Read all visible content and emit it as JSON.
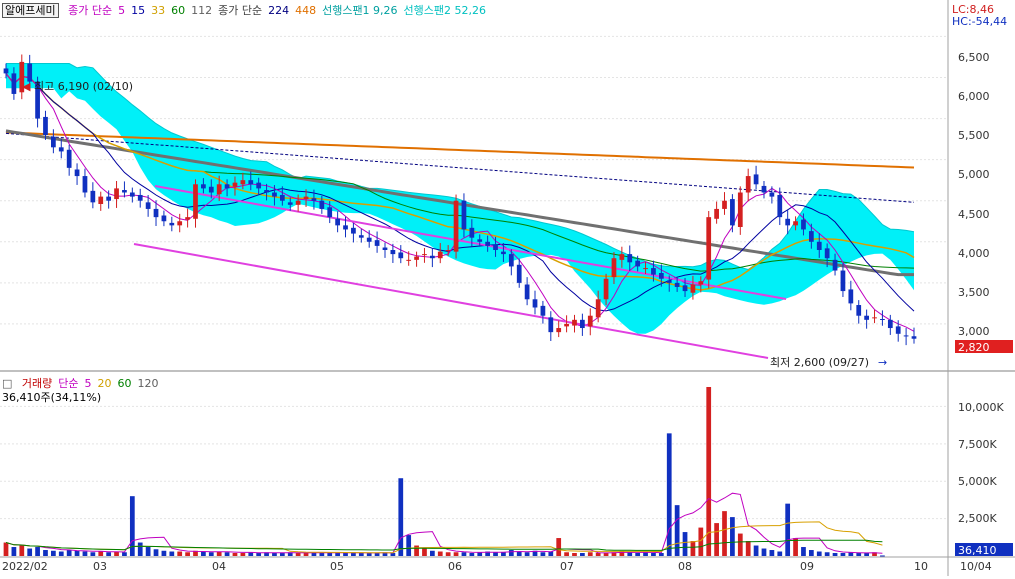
{
  "stock_name": "알에프세미",
  "price_legend": {
    "items": [
      {
        "text": "종가 단순",
        "color": "#c000c0"
      },
      {
        "text": "5",
        "color": "#c000c0"
      },
      {
        "text": "15",
        "color": "#0000a0"
      },
      {
        "text": "33",
        "color": "#d0a000"
      },
      {
        "text": "60",
        "color": "#008000"
      },
      {
        "text": "112",
        "color": "#606060"
      },
      {
        "text": "종가 단순",
        "color": "#404040"
      },
      {
        "text": "224",
        "color": "#000080"
      },
      {
        "text": "448",
        "color": "#e07000"
      },
      {
        "text": "선행스팬1 9,26",
        "color": "#00a0a0"
      },
      {
        "text": "선행스팬2 52,26",
        "color": "#00c0c0"
      }
    ]
  },
  "corner_info": {
    "lc": "LC:8,46",
    "hc": "HC:-54,44"
  },
  "high_annotation": "최고 6,190 (02/10)",
  "low_annotation": "최저 2,600 (09/27)",
  "price_axis": {
    "ticks": [
      "6,500",
      "6,000",
      "5,500",
      "5,000",
      "4,500",
      "4,000",
      "3,500",
      "3,000"
    ],
    "current": "2,820"
  },
  "volume_legend": {
    "items": [
      {
        "text": "거래량",
        "color": "#c00000"
      },
      {
        "text": "단순",
        "color": "#c000c0"
      },
      {
        "text": "5",
        "color": "#c000c0"
      },
      {
        "text": "20",
        "color": "#d0a000"
      },
      {
        "text": "60",
        "color": "#008000"
      },
      {
        "text": "120",
        "color": "#606060"
      }
    ],
    "value": "36,410주(34,11%)"
  },
  "volume_axis": {
    "ticks": [
      "10,000K",
      "7,500K",
      "5,000K",
      "2,500K"
    ],
    "current": "36,410"
  },
  "x_axis": {
    "labels": [
      "2022/02",
      "03",
      "04",
      "05",
      "06",
      "07",
      "08",
      "09",
      "10",
      "10/04"
    ]
  },
  "colors": {
    "up": "#d42020",
    "down": "#1030c0",
    "cloud": "#00f0f8",
    "trendline": "#e040e0",
    "ma448": "#e07000",
    "ma224": "#000080",
    "ma112": "#707070"
  },
  "chart_data": {
    "type": "candlestick",
    "price_ylim": [
      2500,
      6700
    ],
    "volume_ylim": [
      0,
      11500000
    ],
    "close": [
      6050,
      5800,
      6190,
      5950,
      5500,
      5300,
      5150,
      5100,
      4900,
      4800,
      4600,
      4480,
      4550,
      4500,
      4650,
      4600,
      4550,
      4500,
      4400,
      4300,
      4250,
      4200,
      4250,
      4300,
      4700,
      4650,
      4600,
      4700,
      4650,
      4720,
      4750,
      4700,
      4650,
      4600,
      4550,
      4500,
      4450,
      4500,
      4550,
      4500,
      4400,
      4300,
      4200,
      4150,
      4100,
      4050,
      4000,
      3950,
      3900,
      3850,
      3800,
      3780,
      3820,
      3850,
      3800,
      3880,
      3900,
      4500,
      4150,
      4050,
      4000,
      3950,
      3900,
      3850,
      3700,
      3500,
      3300,
      3200,
      3100,
      2900,
      2950,
      3000,
      3050,
      2950,
      3100,
      3300,
      3550,
      3800,
      3850,
      3750,
      3700,
      3680,
      3600,
      3550,
      3500,
      3450,
      3400,
      3480,
      3520,
      4300,
      4400,
      4500,
      4200,
      4600,
      4800,
      4700,
      4600,
      4550,
      4300,
      4200,
      4250,
      4150,
      4000,
      3900,
      3800,
      3650,
      3400,
      3250,
      3100,
      3050,
      3080,
      3050,
      2950,
      2880,
      2850,
      2820
    ],
    "volume": [
      900000,
      600000,
      700000,
      500000,
      600000,
      400000,
      350000,
      300000,
      400000,
      350000,
      300000,
      250000,
      300000,
      250000,
      300000,
      250000,
      4000000,
      900000,
      600000,
      450000,
      350000,
      300000,
      300000,
      250000,
      350000,
      300000,
      250000,
      300000,
      250000,
      200000,
      200000,
      250000,
      200000,
      250000,
      200000,
      200000,
      250000,
      200000,
      200000,
      250000,
      200000,
      250000,
      200000,
      200000,
      250000,
      200000,
      200000,
      200000,
      250000,
      200000,
      5200000,
      1400000,
      700000,
      500000,
      350000,
      300000,
      250000,
      250000,
      250000,
      200000,
      250000,
      300000,
      250000,
      250000,
      400000,
      300000,
      250000,
      350000,
      250000,
      300000,
      1200000,
      250000,
      200000,
      200000,
      250000,
      200000,
      200000,
      250000,
      300000,
      250000,
      200000,
      250000,
      200000,
      200000,
      8200000,
      3400000,
      1600000,
      1000000,
      1900000,
      11300000,
      2200000,
      3000000,
      2600000,
      1500000,
      1000000,
      700000,
      500000,
      400000,
      300000,
      3500000,
      1200000,
      600000,
      400000,
      300000,
      250000,
      200000,
      200000,
      250000,
      200000,
      200000,
      250000,
      36410
    ]
  }
}
